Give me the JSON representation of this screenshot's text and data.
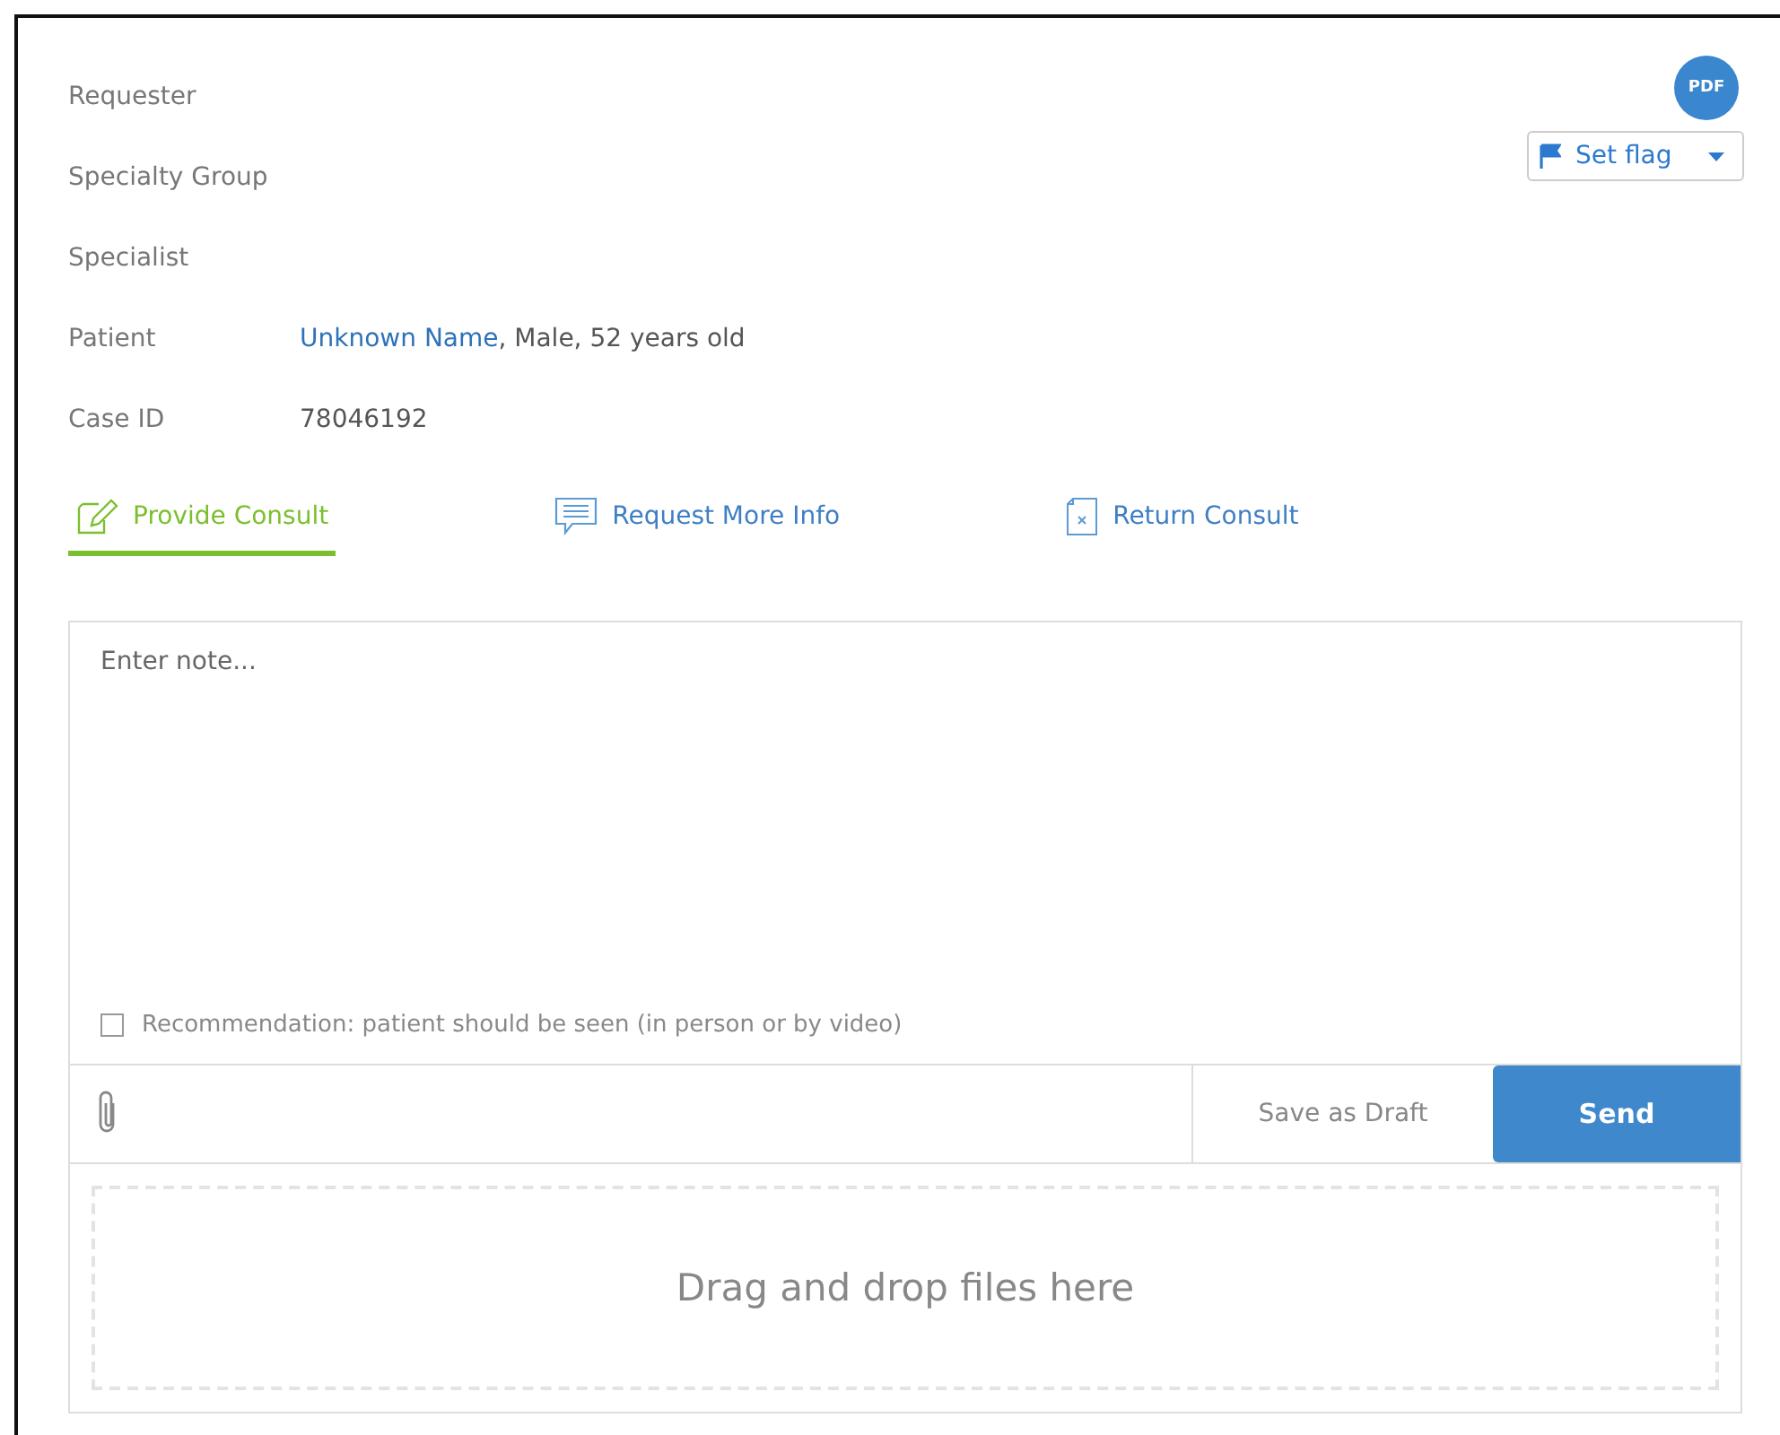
{
  "pdf_button": {
    "label": "PDF"
  },
  "flag_button": {
    "label": "Set flag"
  },
  "fields": [
    {
      "label": "Requester"
    },
    {
      "label": "Specialty Group"
    },
    {
      "label": "Specialist"
    },
    {
      "label": "Patient",
      "link": "Unknown Name",
      "value": ", Male, 52 years old"
    },
    {
      "label": "Case ID",
      "value": "78046192"
    }
  ],
  "tabs": [
    {
      "label": "Provide Consult",
      "kind": "edit",
      "selected": true
    },
    {
      "label": "Request More Info",
      "kind": "comment",
      "selected": false
    },
    {
      "label": "Return Consult",
      "kind": "return",
      "selected": false
    }
  ],
  "note": {
    "placeholder": "Enter note..."
  },
  "recommendation": {
    "label": "Recommendation: patient should be seen (in person or by video)",
    "checked": false
  },
  "buttons": {
    "draft": "Save as Draft",
    "send": "Send"
  },
  "dropzone": {
    "text": "Drag and drop files here"
  }
}
